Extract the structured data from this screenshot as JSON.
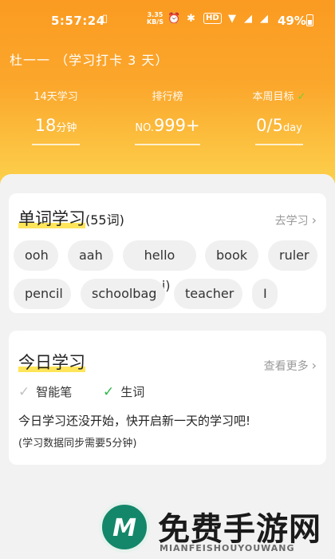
{
  "status_bar": {
    "time": "5:57:24",
    "net_speed_value": "3.35",
    "net_speed_unit": "KB/S",
    "hd": "HD",
    "battery_pct": "49%"
  },
  "header": {
    "user_line": "杜一一  （学习打卡 3 天）",
    "stats": [
      {
        "label": "14天学习",
        "value": "18",
        "unit": "分钟"
      },
      {
        "label": "排行榜",
        "prefix": "NO.",
        "value": "999+"
      },
      {
        "label": "本周目标",
        "value": "0/5",
        "unit": "day"
      }
    ]
  },
  "words_card": {
    "title": "单词学习",
    "count": "(55词)",
    "link": "去学习",
    "chips": [
      "ooh",
      "aah",
      "hello (hi)",
      "book",
      "ruler",
      "pencil",
      "schoolbag",
      "teacher",
      "I"
    ]
  },
  "today_card": {
    "title": "今日学习",
    "link": "查看更多",
    "legend": [
      "智能笔",
      "生词"
    ],
    "message": "今日学习还没开始，快开启新一天的学习吧!",
    "note": "(学习数据同步需要5分钟)"
  },
  "watermark": {
    "logo_letter": "M",
    "big_text": "免费手游网",
    "small_text": "MIANFEISHOUYOUWANG"
  },
  "colors": {
    "header_top": "#fb9b21",
    "header_bottom": "#fcd24d",
    "highlight": "#ffe55a",
    "green": "#2db84a",
    "watermark_green": "#14876a"
  }
}
